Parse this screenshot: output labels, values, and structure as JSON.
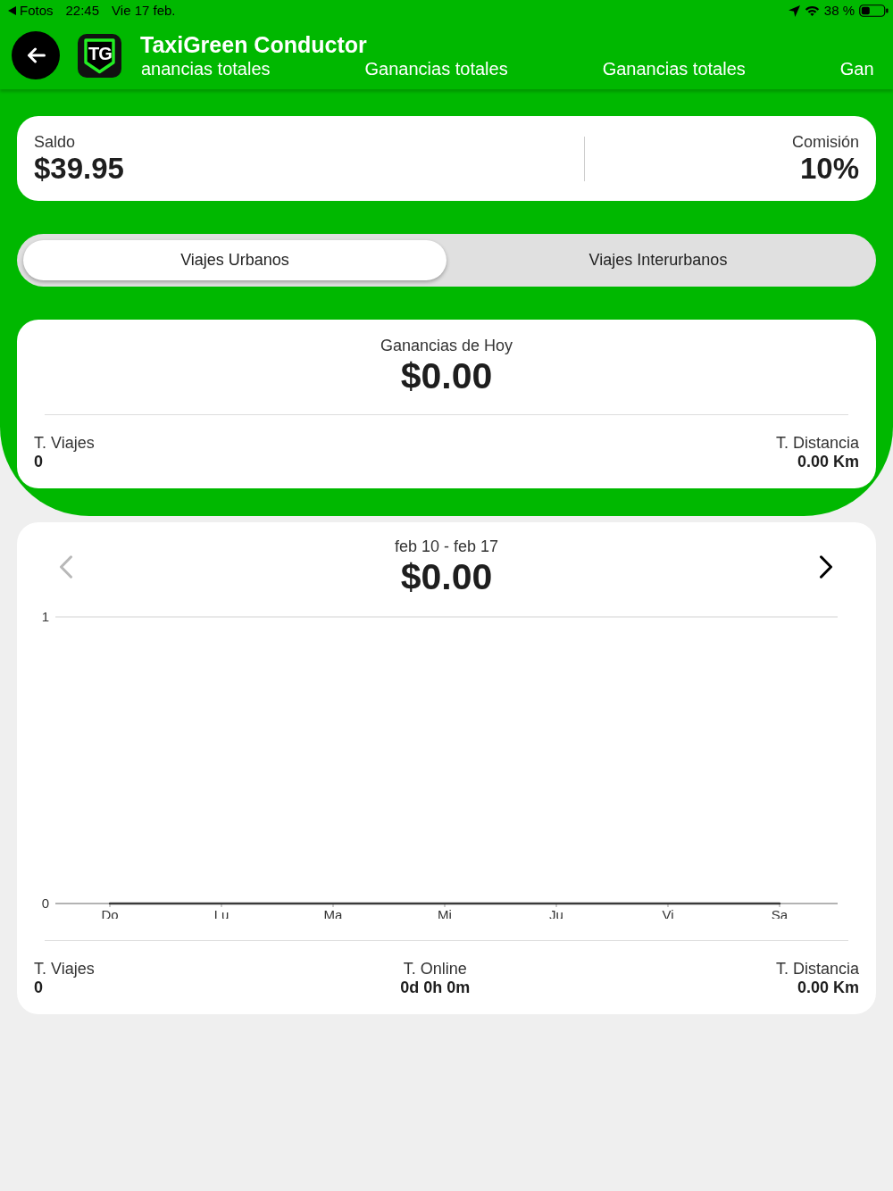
{
  "status_bar": {
    "back_label": "Fotos",
    "time": "22:45",
    "date": "Vie 17 feb.",
    "battery": "38 %"
  },
  "header": {
    "title": "TaxiGreen Conductor",
    "logo_text": "TG",
    "ticker": [
      "anancias totales",
      "Ganancias totales",
      "Ganancias totales",
      "Gan"
    ]
  },
  "balance": {
    "label": "Saldo",
    "value": "$39.95"
  },
  "commission": {
    "label": "Comisión",
    "value": "10%"
  },
  "tabs": [
    {
      "label": "Viajes Urbanos",
      "selected": true
    },
    {
      "label": "Viajes Interurbanos",
      "selected": false
    }
  ],
  "today": {
    "title": "Ganancias de Hoy",
    "amount": "$0.00",
    "stats": [
      {
        "label": "T. Viajes",
        "value": "0"
      },
      {
        "label": "T. Distancia",
        "value": "0.00 Km"
      }
    ]
  },
  "week": {
    "range": "feb 10 - feb 17",
    "amount": "$0.00",
    "prev_disabled": true,
    "next_disabled": false,
    "chart_data": {
      "type": "line",
      "categories": [
        "Do",
        "Lu",
        "Ma",
        "Mi",
        "Ju",
        "Vi",
        "Sa"
      ],
      "values": [
        0,
        0,
        0,
        0,
        0,
        0,
        0
      ],
      "ylim": [
        0,
        1
      ],
      "yticks": [
        0,
        1
      ]
    },
    "stats": [
      {
        "label": "T. Viajes",
        "value": "0"
      },
      {
        "label": "T. Online",
        "value": "0d 0h 0m"
      },
      {
        "label": "T. Distancia",
        "value": "0.00 Km"
      }
    ]
  }
}
